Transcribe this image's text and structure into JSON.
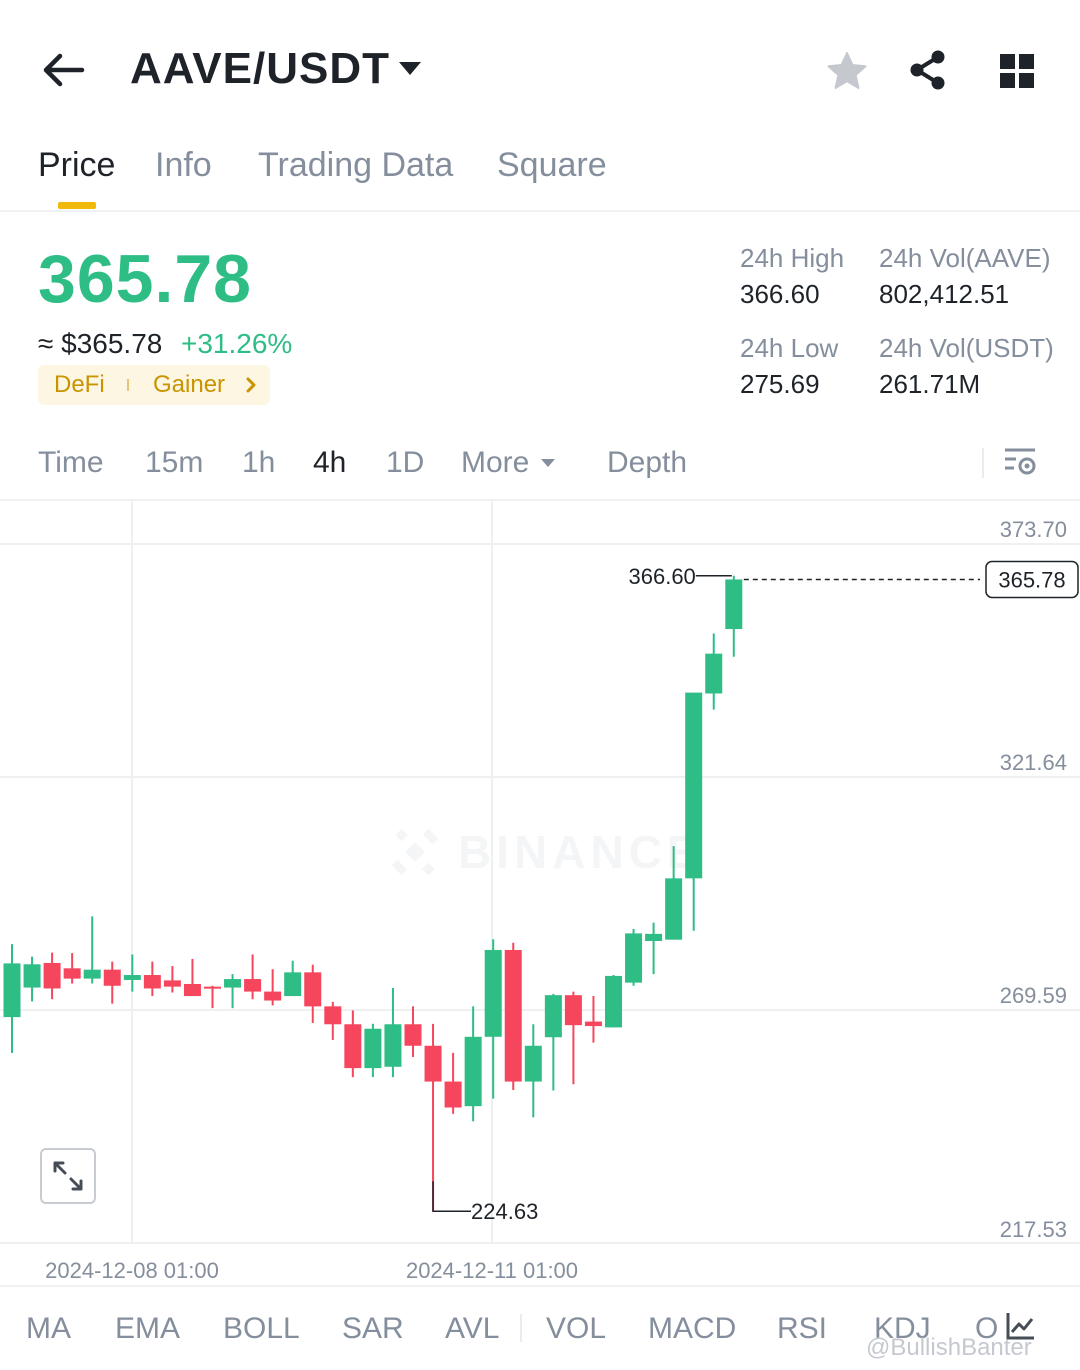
{
  "header": {
    "pair": "AAVE/USDT",
    "icons": [
      "back-arrow-icon",
      "caret-down-icon",
      "star-icon",
      "share-icon",
      "grid-icon"
    ]
  },
  "tabs": [
    {
      "label": "Price",
      "active": true
    },
    {
      "label": "Info",
      "active": false
    },
    {
      "label": "Trading Data",
      "active": false
    },
    {
      "label": "Square",
      "active": false
    }
  ],
  "ticker": {
    "last_price": "365.78",
    "fiat_price": "≈ $365.78",
    "change_pct": "+31.26%",
    "tags": [
      "DeFi",
      "Gainer"
    ],
    "high_label": "24h High",
    "high_value": "366.60",
    "low_label": "24h Low",
    "low_value": "275.69",
    "vol_base_label": "24h Vol(AAVE)",
    "vol_base_value": "802,412.51",
    "vol_quote_label": "24h Vol(USDT)",
    "vol_quote_value": "261.71M"
  },
  "intervals": [
    {
      "label": "Time",
      "active": false
    },
    {
      "label": "15m",
      "active": false
    },
    {
      "label": "1h",
      "active": false
    },
    {
      "label": "4h",
      "active": true
    },
    {
      "label": "1D",
      "active": false
    },
    {
      "label": "More",
      "active": false
    },
    {
      "label": "Depth",
      "active": false
    }
  ],
  "indicators": [
    "MA",
    "EMA",
    "BOLL",
    "SAR",
    "AVL",
    "VOL",
    "MACD",
    "RSI",
    "KDJ",
    "O"
  ],
  "watermark": "BINANCE",
  "credit": "@BullishBanter",
  "colors": {
    "up": "#2ebd85",
    "down": "#f6465d",
    "accent": "#f0b90b"
  },
  "chart_data": {
    "type": "candlestick",
    "interval": "4h",
    "ylim": [
      217.53,
      373.7
    ],
    "yticks": [
      "373.70",
      "321.64",
      "269.59",
      "217.53"
    ],
    "xticks": [
      "2024-12-08 01:00",
      "2024-12-11 01:00"
    ],
    "last_price_label": "365.78",
    "high_marker": "366.60",
    "low_marker": "224.63",
    "candles": [
      {
        "o": 268.0,
        "h": 284.3,
        "l": 260.0,
        "c": 280.0
      },
      {
        "o": 274.6,
        "h": 281.5,
        "l": 271.5,
        "c": 279.8
      },
      {
        "o": 280.1,
        "h": 282.4,
        "l": 272.0,
        "c": 274.4
      },
      {
        "o": 278.9,
        "h": 282.3,
        "l": 275.5,
        "c": 276.6
      },
      {
        "o": 276.6,
        "h": 290.5,
        "l": 275.5,
        "c": 278.6
      },
      {
        "o": 278.6,
        "h": 280.4,
        "l": 271.0,
        "c": 275.0
      },
      {
        "o": 276.3,
        "h": 282.0,
        "l": 273.7,
        "c": 277.4
      },
      {
        "o": 277.4,
        "h": 280.4,
        "l": 272.7,
        "c": 274.4
      },
      {
        "o": 276.2,
        "h": 279.4,
        "l": 273.5,
        "c": 274.8
      },
      {
        "o": 275.4,
        "h": 281.0,
        "l": 272.7,
        "c": 272.7
      },
      {
        "o": 274.8,
        "h": 275.0,
        "l": 270.0,
        "c": 274.6
      },
      {
        "o": 274.6,
        "h": 277.6,
        "l": 270.0,
        "c": 276.5
      },
      {
        "o": 276.5,
        "h": 282.0,
        "l": 272.0,
        "c": 273.7
      },
      {
        "o": 273.7,
        "h": 278.7,
        "l": 270.6,
        "c": 271.7
      },
      {
        "o": 272.7,
        "h": 280.6,
        "l": 272.7,
        "c": 278.0
      },
      {
        "o": 278.0,
        "h": 279.7,
        "l": 266.7,
        "c": 270.4
      },
      {
        "o": 270.4,
        "h": 271.4,
        "l": 262.9,
        "c": 266.4
      },
      {
        "o": 266.4,
        "h": 269.5,
        "l": 254.6,
        "c": 256.6
      },
      {
        "o": 256.6,
        "h": 266.5,
        "l": 254.6,
        "c": 265.4
      },
      {
        "o": 256.9,
        "h": 274.5,
        "l": 254.6,
        "c": 266.4
      },
      {
        "o": 266.4,
        "h": 270.4,
        "l": 259.1,
        "c": 261.6
      },
      {
        "o": 261.6,
        "h": 266.5,
        "l": 224.63,
        "c": 253.6
      },
      {
        "o": 253.6,
        "h": 260.0,
        "l": 246.4,
        "c": 247.8
      },
      {
        "o": 248.1,
        "h": 270.4,
        "l": 244.7,
        "c": 263.6
      },
      {
        "o": 263.6,
        "h": 285.4,
        "l": 249.8,
        "c": 283.0
      },
      {
        "o": 283.0,
        "h": 284.6,
        "l": 251.7,
        "c": 253.6
      },
      {
        "o": 253.6,
        "h": 266.4,
        "l": 245.6,
        "c": 261.6
      },
      {
        "o": 263.5,
        "h": 273.2,
        "l": 251.6,
        "c": 272.9
      },
      {
        "o": 272.9,
        "h": 273.7,
        "l": 253.0,
        "c": 266.2
      },
      {
        "o": 267.0,
        "h": 272.7,
        "l": 262.3,
        "c": 266.0
      },
      {
        "o": 265.7,
        "h": 277.4,
        "l": 265.7,
        "c": 277.2
      },
      {
        "o": 275.7,
        "h": 287.7,
        "l": 275.0,
        "c": 286.7
      },
      {
        "o": 285.0,
        "h": 289.1,
        "l": 277.6,
        "c": 286.6
      },
      {
        "o": 285.3,
        "h": 306.2,
        "l": 285.3,
        "c": 299.0
      },
      {
        "o": 299.0,
        "h": 339.0,
        "l": 287.3,
        "c": 340.5
      },
      {
        "o": 340.3,
        "h": 353.7,
        "l": 336.7,
        "c": 349.2
      },
      {
        "o": 354.7,
        "h": 366.6,
        "l": 348.5,
        "c": 365.78
      }
    ]
  }
}
